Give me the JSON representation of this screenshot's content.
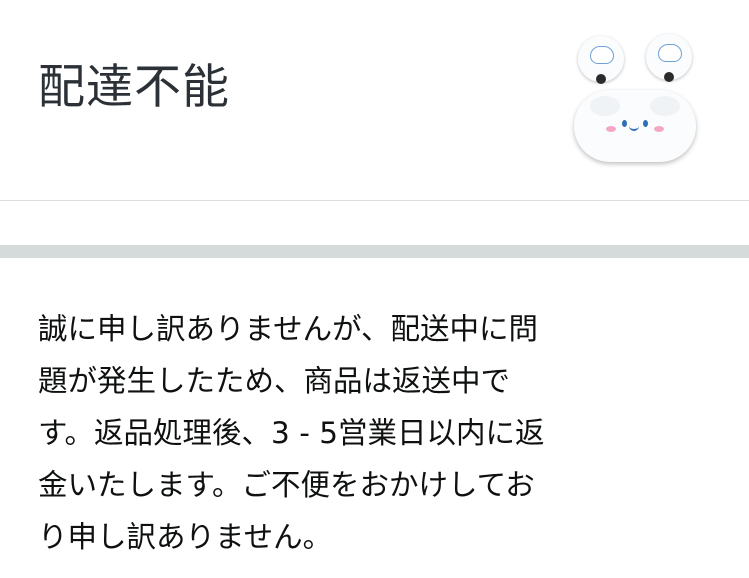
{
  "header": {
    "status_title": "配達不能"
  },
  "product": {
    "icon": "earbuds-product-thumbnail"
  },
  "message": {
    "lines": [
      "誠に申し訳ありませんが、配送中に問",
      "題が発生したため、商品は返送中で",
      "す。返品処理後、3 - 5営業日以内に返",
      "金いたします。ご不便をおかけしてお",
      "り申し訳ありません。"
    ]
  },
  "colors": {
    "title_text": "#2b3136",
    "body_text": "#0f1111",
    "thick_divider": "#d5dbdb",
    "thin_divider": "#dcdfe0"
  }
}
